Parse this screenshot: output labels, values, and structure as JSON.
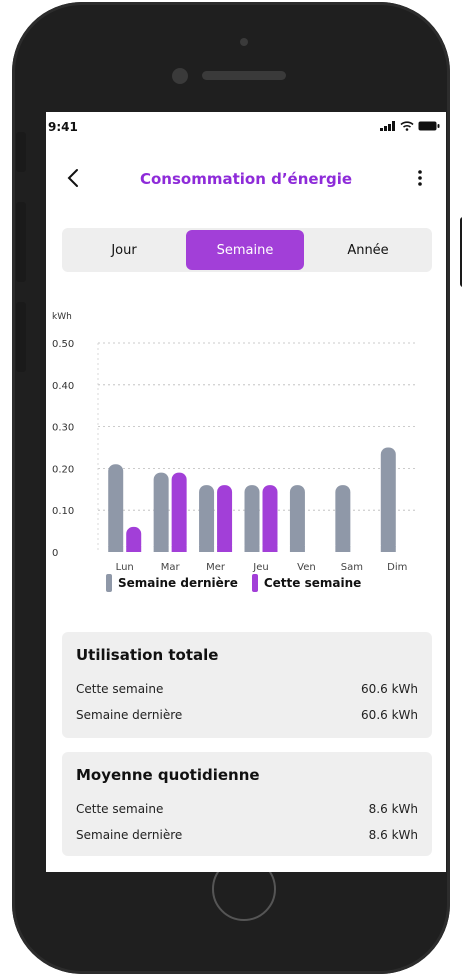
{
  "status": {
    "time": "9:41"
  },
  "header": {
    "title": "Consommation d’énergie"
  },
  "tabs": [
    {
      "label": "Jour",
      "active": false
    },
    {
      "label": "Semaine",
      "active": true
    },
    {
      "label": "Année",
      "active": false
    }
  ],
  "colors": {
    "accent": "#a23fd8",
    "last_week": "#8f98a8",
    "this_week": "#a23fd8",
    "card_bg": "#efefef"
  },
  "chart_data": {
    "type": "bar",
    "unit": "kWh",
    "categories": [
      "Lun",
      "Mar",
      "Mer",
      "Jeu",
      "Ven",
      "Sam",
      "Dim"
    ],
    "ylim": [
      0,
      0.5
    ],
    "yticks": [
      "0",
      "0.10",
      "0.20",
      "0.30",
      "0.40",
      "0.50"
    ],
    "grid": true,
    "series": [
      {
        "name": "Semaine dernière",
        "values": [
          0.21,
          0.19,
          0.16,
          0.16,
          0.16,
          0.16,
          0.25
        ]
      },
      {
        "name": "Cette semaine",
        "values": [
          0.06,
          0.19,
          0.16,
          0.16,
          null,
          null,
          null
        ]
      }
    ],
    "legend": "bottom"
  },
  "cards": [
    {
      "title": "Utilisation totale",
      "rows": [
        {
          "label": "Cette semaine",
          "value": "60.6 kWh"
        },
        {
          "label": "Semaine dernière",
          "value": "60.6 kWh"
        }
      ]
    },
    {
      "title": "Moyenne quotidienne",
      "rows": [
        {
          "label": "Cette semaine",
          "value": "8.6 kWh"
        },
        {
          "label": "Semaine dernière",
          "value": "8.6 kWh"
        }
      ]
    }
  ]
}
